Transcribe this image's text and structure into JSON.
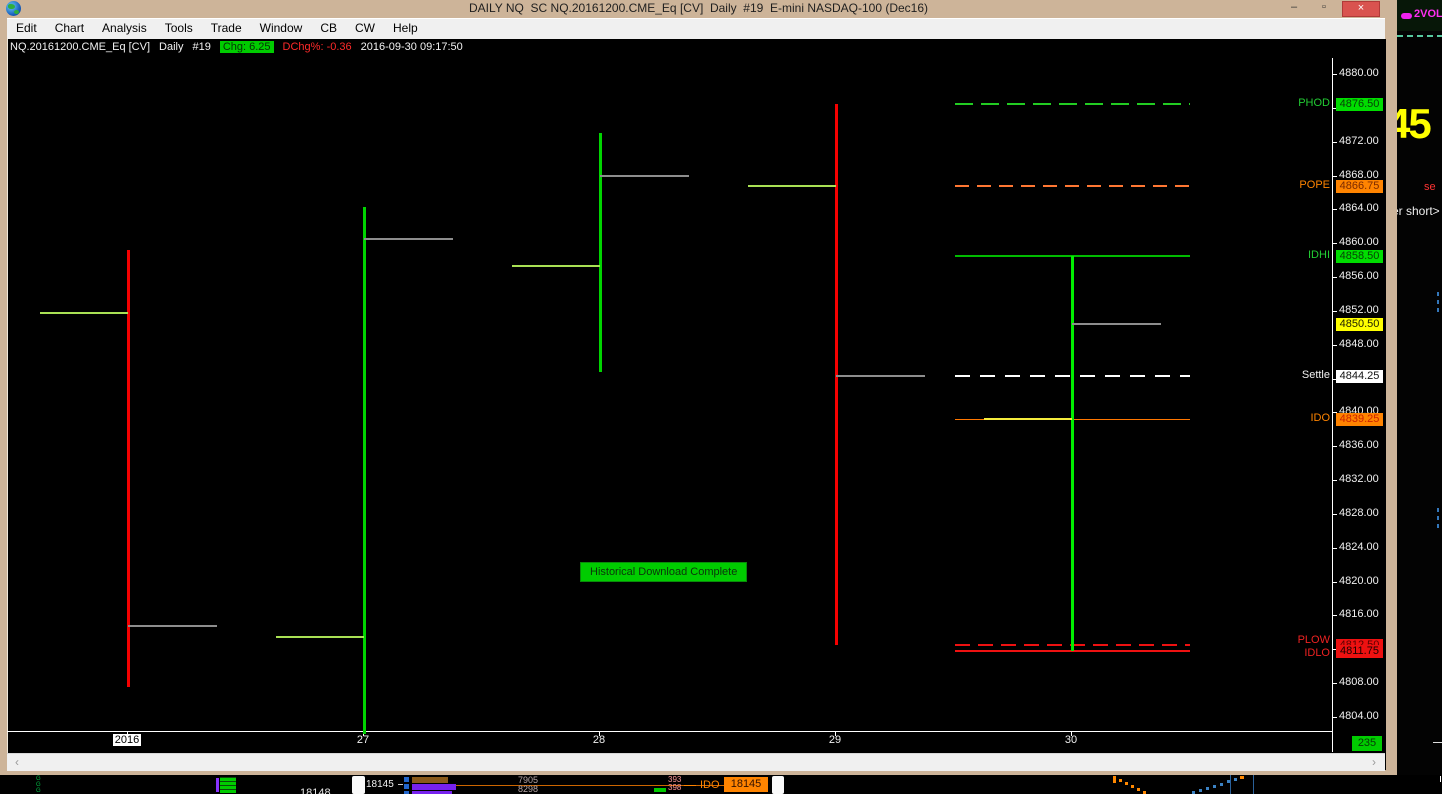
{
  "window": {
    "title": "DAILY NQ  SC NQ.20161200.CME_Eq [CV]  Daily  #19  E-mini NASDAQ-100 (Dec16)",
    "controls": {
      "minimize": "–",
      "maximize": "▫",
      "close": "×"
    }
  },
  "menu": {
    "items": [
      "Edit",
      "Chart",
      "Analysis",
      "Tools",
      "Trade",
      "Window",
      "CB",
      "CW",
      "Help"
    ]
  },
  "info_bar": {
    "symbol": "NQ.20161200.CME_Eq [CV]",
    "period": "Daily",
    "chart_number": "#19",
    "chg": "Chg: 6.25",
    "dchg": "DChg%: -0.36",
    "timestamp": "2016-09-30 09:17:50"
  },
  "message": "Historical Download Complete",
  "corner_badge": "235",
  "scrollbar": {
    "left_arrow": "‹",
    "right_arrow": "›"
  },
  "colors": {
    "bar_up": "#00d400",
    "bar_up_today": "#00ee00",
    "bar_down": "#f40000",
    "open_tick": "#a9e154",
    "close_tick": "#8d8d8d",
    "today_open_tick": "#f5ec3d"
  },
  "chart_data": {
    "type": "ohlc-bar",
    "symbol": "NQ.20161200.CME_Eq [CV]",
    "timeframe": "Daily",
    "title": "E-mini NASDAQ-100 (Dec16)",
    "ylim": [
      4802,
      4882
    ],
    "y_ticks": [
      4880,
      4876,
      4872,
      4868,
      4864,
      4860,
      4856,
      4852,
      4848,
      4844,
      4840,
      4836,
      4832,
      4828,
      4824,
      4820,
      4816,
      4812,
      4808,
      4804
    ],
    "x_labels": [
      "2016",
      "27",
      "28",
      "29",
      "30"
    ],
    "bars": [
      {
        "label": "2016",
        "open": 4851.75,
        "high": 4859.25,
        "low": 4807.5,
        "close": 4814.75,
        "direction": "down"
      },
      {
        "label": "27",
        "open": 4813.5,
        "high": 4864.25,
        "low": 4802.0,
        "close": 4860.5,
        "direction": "up",
        "low_clipped": true
      },
      {
        "label": "28",
        "open": 4857.25,
        "high": 4873.0,
        "low": 4844.75,
        "close": 4868.0,
        "direction": "up"
      },
      {
        "label": "29",
        "open": 4866.75,
        "high": 4876.5,
        "low": 4812.5,
        "close": 4844.25,
        "direction": "down"
      },
      {
        "label": "30",
        "open": 4839.25,
        "high": 4858.5,
        "low": 4811.75,
        "close": 4850.5,
        "direction": "up",
        "today": true
      }
    ],
    "levels": [
      {
        "name": "PHOD",
        "price": 4876.5,
        "style": "dashed",
        "color": "#22cc22",
        "dash": 18,
        "gap": 8,
        "thick": 2
      },
      {
        "name": "POPE",
        "price": 4866.75,
        "style": "dashed",
        "color": "#ff7733",
        "dash": 14,
        "gap": 8,
        "thick": 2
      },
      {
        "name": "IDHI",
        "price": 4858.5,
        "style": "solid",
        "color": "#00bb00",
        "thick": 2
      },
      {
        "name": "Settle",
        "price": 4844.25,
        "style": "dashed",
        "color": "#ffffff",
        "dash": 15,
        "gap": 10,
        "thick": 2
      },
      {
        "name": "IDO",
        "price": 4839.25,
        "style": "solid",
        "color": "#ff7700",
        "thick": 1
      },
      {
        "name": "PLOW",
        "price": 4812.5,
        "style": "dashed",
        "color": "#ee1111",
        "dash": 15,
        "gap": 8,
        "thick": 2
      },
      {
        "name": "IDLO",
        "price": 4811.75,
        "style": "solid",
        "color": "#ee1111",
        "thick": 2
      }
    ],
    "last_price": 4850.5
  },
  "axis_badges": [
    {
      "label": "PHOD",
      "value": "4876.50",
      "price": 4876.5,
      "bg": "#00dd00",
      "fg": "#063f06",
      "label_color": "#22cc33",
      "dy": 0
    },
    {
      "label": "POPE",
      "value": "4866.75",
      "price": 4866.75,
      "bg": "#ff8400",
      "fg": "#7c2a00",
      "label_color": "#ff8400",
      "dy": 0
    },
    {
      "label": "IDHI",
      "value": "4858.50",
      "price": 4858.5,
      "bg": "#00dd00",
      "fg": "#063f06",
      "label_color": "#22cc33",
      "dy": 0
    },
    {
      "label": "",
      "value": "4850.50",
      "price": 4850.5,
      "bg": "#ffff00",
      "fg": "#222200",
      "label_color": "",
      "dy": 0
    },
    {
      "label": "Settle",
      "value": "4844.25",
      "price": 4844.25,
      "bg": "#ffffff",
      "fg": "#111111",
      "label_color": "#f0f0f0",
      "dy": 0
    },
    {
      "label": "IDO",
      "value": "4839.25",
      "price": 4839.25,
      "bg": "#ff8400",
      "fg": "#cc2200",
      "label_color": "#ff8400",
      "dy": 0
    },
    {
      "label": "PLOW",
      "value": "4812.50",
      "price": 4812.5,
      "bg": "#ee1111",
      "fg": "#5a0000",
      "label_color": "#ee2222",
      "dy": -4
    },
    {
      "label": "IDLO",
      "value": "4811.75",
      "price": 4811.75,
      "bg": "#ee1111",
      "fg": "#1c0000",
      "label_color": "#ee2222",
      "dy": 3
    }
  ],
  "background_right": {
    "vol_label": "2VOL",
    "big_number": "45",
    "se_text": "se",
    "short_text": "er short>"
  },
  "background_bottom": {
    "g_column": "G\nG\nG",
    "clipped_price": "18148",
    "scale_price": "18145",
    "pair_top": "7905",
    "pair_bottom": "8298",
    "small_top": "393",
    "small_bottom": "398",
    "ido_label": "IDO",
    "ido_value": "18145"
  }
}
